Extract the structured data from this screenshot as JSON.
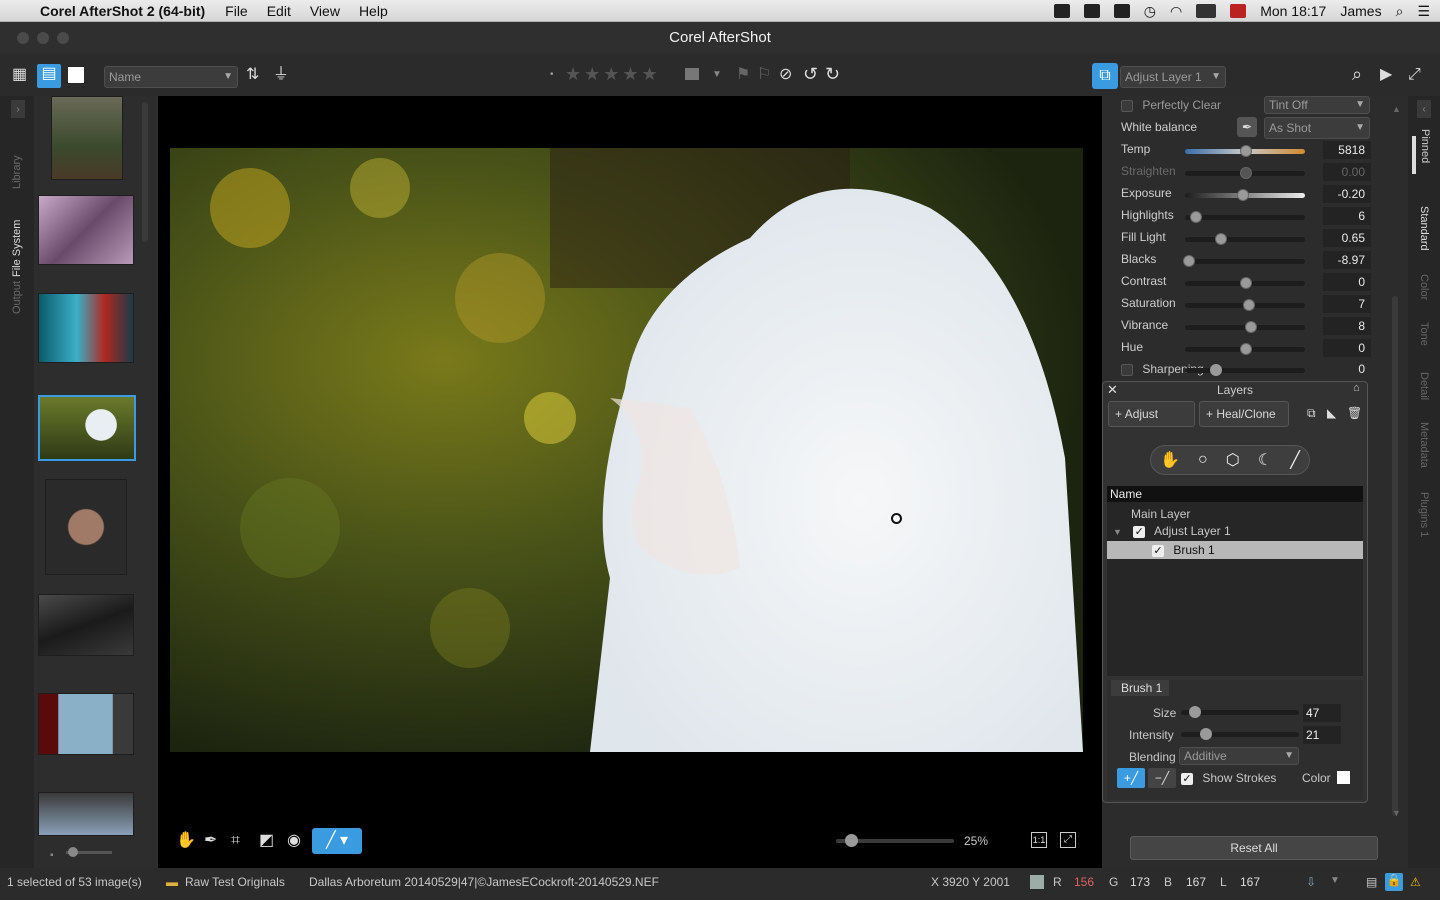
{
  "menubar": {
    "app_name": "Corel AfterShot 2 (64-bit)",
    "items": [
      "File",
      "Edit",
      "View",
      "Help"
    ],
    "clock": "Mon 18:17",
    "user": "James"
  },
  "window": {
    "title": "Corel AfterShot"
  },
  "toolbar": {
    "sort_field": "Name",
    "layer_select": "Adjust Layer 1"
  },
  "left_tabs": [
    "Library",
    "File System",
    "Output"
  ],
  "right_tabs": [
    "Pinned",
    "Standard",
    "Color",
    "Tone",
    "Detail",
    "Metadata",
    "Plugins 1"
  ],
  "adjustments": {
    "perfectly_clear": "Perfectly Clear",
    "tint": "Tint Off",
    "white_balance_label": "White balance",
    "white_balance_value": "As Shot",
    "sliders": [
      {
        "label": "Temp",
        "value": "5818",
        "level": 0.5,
        "dim": false
      },
      {
        "label": "Straighten",
        "value": "0.00",
        "level": 0.5,
        "dim": true
      },
      {
        "label": "Exposure",
        "value": "-0.20",
        "level": 0.47,
        "dim": false
      },
      {
        "label": "Highlights",
        "value": "6",
        "level": 0.06,
        "dim": false
      },
      {
        "label": "Fill Light",
        "value": "0.65",
        "level": 0.28,
        "dim": false
      },
      {
        "label": "Blacks",
        "value": "-8.97",
        "level": 0.0,
        "dim": false
      },
      {
        "label": "Contrast",
        "value": "0",
        "level": 0.5,
        "dim": false
      },
      {
        "label": "Saturation",
        "value": "7",
        "level": 0.53,
        "dim": false
      },
      {
        "label": "Vibrance",
        "value": "8",
        "level": 0.54,
        "dim": false
      },
      {
        "label": "Hue",
        "value": "0",
        "level": 0.5,
        "dim": false
      }
    ],
    "sharpening_label": "Sharpening",
    "sharpening_value": "0"
  },
  "layers": {
    "title": "Layers",
    "adjust_button": "Adjust",
    "heal_button": "Heal/Clone",
    "column_header": "Name",
    "items": [
      "Main Layer",
      "Adjust Layer 1",
      "Brush 1"
    ],
    "brush": {
      "title": "Brush 1",
      "size_label": "Size",
      "size_value": "47",
      "intensity_label": "Intensity",
      "intensity_value": "21",
      "blending_label": "Blending",
      "blending_value": "Additive",
      "show_strokes": "Show Strokes",
      "color_label": "Color"
    }
  },
  "viewer": {
    "zoom": "25%",
    "one_to_one": "1:1"
  },
  "reset_all": "Reset All",
  "status": {
    "selection": "1 selected of 53 image(s)",
    "folder": "Raw Test Originals",
    "filename": "Dallas Arboretum 20140529|47|©JamesECockroft-20140529.NEF",
    "coords": "X 3920  Y 2001",
    "r_label": "R",
    "r_value": "156",
    "g_label": "G",
    "g_value": "173",
    "b_label": "B",
    "b_value": "167",
    "l_label": "L",
    "l_value": "167"
  }
}
